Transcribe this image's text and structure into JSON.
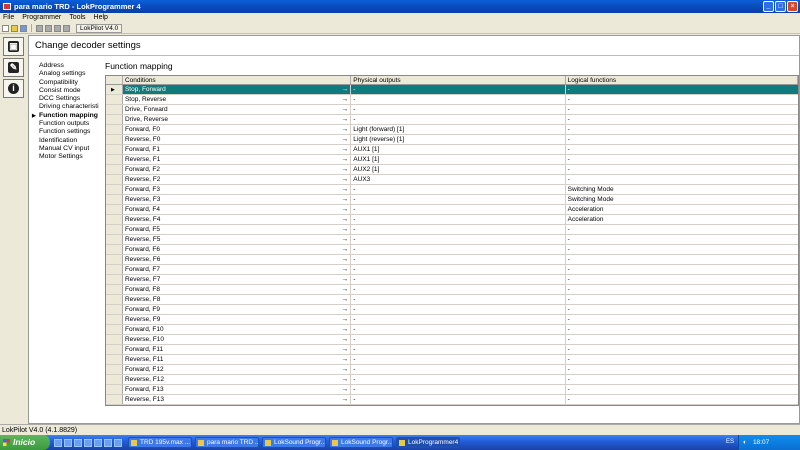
{
  "window": {
    "title": "para mario TRD - LokProgrammer 4"
  },
  "menu": [
    "File",
    "Programmer",
    "Tools",
    "Help"
  ],
  "toolbar": {
    "tab_label": "LokPilot V4.0"
  },
  "page": {
    "header": "Change decoder settings",
    "section_title": "Function mapping"
  },
  "nav": {
    "items": [
      "Address",
      "Analog settings",
      "Compatibility",
      "Consist mode",
      "DCC Settings",
      "Driving characteristi",
      "Function mapping",
      "Function outputs",
      "Function settings",
      "Identification",
      "Manual CV input",
      "Motor Settings"
    ],
    "active": "Function mapping"
  },
  "grid": {
    "headers": [
      "Conditions",
      "Physical outputs",
      "Logical functions"
    ],
    "rows": [
      [
        "Stop, Forward",
        "-",
        "-"
      ],
      [
        "Stop, Reverse",
        "-",
        "-"
      ],
      [
        "Drive, Forward",
        "-",
        "-"
      ],
      [
        "Drive, Reverse",
        "-",
        "-"
      ],
      [
        "Forward, F0",
        "Light (forward) [1]",
        "-"
      ],
      [
        "Reverse, F0",
        "Light (reverse) [1]",
        "-"
      ],
      [
        "Forward, F1",
        "AUX1 [1]",
        "-"
      ],
      [
        "Reverse, F1",
        "AUX1 [1]",
        "-"
      ],
      [
        "Forward, F2",
        "AUX2 [1]",
        "-"
      ],
      [
        "Reverse, F2",
        "AUX3",
        "-"
      ],
      [
        "Forward, F3",
        "-",
        "Switching Mode"
      ],
      [
        "Reverse, F3",
        "-",
        "Switching Mode"
      ],
      [
        "Forward, F4",
        "-",
        "Acceleration"
      ],
      [
        "Reverse, F4",
        "-",
        "Acceleration"
      ],
      [
        "Forward, F5",
        "-",
        "-"
      ],
      [
        "Reverse, F5",
        "-",
        "-"
      ],
      [
        "Forward, F6",
        "-",
        "-"
      ],
      [
        "Reverse, F6",
        "-",
        "-"
      ],
      [
        "Forward, F7",
        "-",
        "-"
      ],
      [
        "Reverse, F7",
        "-",
        "-"
      ],
      [
        "Forward, F8",
        "-",
        "-"
      ],
      [
        "Reverse, F8",
        "-",
        "-"
      ],
      [
        "Forward, F9",
        "-",
        "-"
      ],
      [
        "Reverse, F9",
        "-",
        "-"
      ],
      [
        "Forward, F10",
        "-",
        "-"
      ],
      [
        "Reverse, F10",
        "-",
        "-"
      ],
      [
        "Forward, F11",
        "-",
        "-"
      ],
      [
        "Reverse, F11",
        "-",
        "-"
      ],
      [
        "Forward, F12",
        "-",
        "-"
      ],
      [
        "Reverse, F12",
        "-",
        "-"
      ],
      [
        "Forward, F13",
        "-",
        "-"
      ],
      [
        "Reverse, F13",
        "-",
        "-"
      ]
    ],
    "selected_row": 0,
    "selected_color": "#107b7b"
  },
  "status": {
    "text": "LokPilot V4.0  (4.1.8829)"
  },
  "taskbar": {
    "start": "Inicio",
    "tasks": [
      "TRD 195v.max ...",
      "para mario TRD ...",
      "LokSound Progr...",
      "LokSound Progr...",
      "LokProgrammer4"
    ],
    "active_task": 4,
    "lang": "ES",
    "clock": "18:07"
  }
}
